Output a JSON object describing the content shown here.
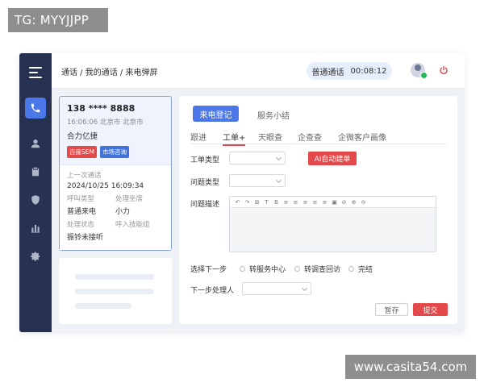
{
  "watermark": {
    "top": "TG: MYYJJPP",
    "bottom": "www.casita54.com"
  },
  "header": {
    "breadcrumb": "通话 / 我的通话 / 来电弹屏",
    "call_type": "普通通话",
    "call_timer": "00:08:12"
  },
  "sidebar": {
    "items": [
      {
        "icon": "phone-icon",
        "active": true
      },
      {
        "icon": "user-icon",
        "active": false
      },
      {
        "icon": "clipboard-icon",
        "active": false
      },
      {
        "icon": "shield-icon",
        "active": false
      },
      {
        "icon": "bar-chart-icon",
        "active": false
      },
      {
        "icon": "gear-icon",
        "active": false
      }
    ]
  },
  "caller": {
    "phone": "138 **** 8888",
    "time_location": "16:06:06  北京市 北京市",
    "company": "合力亿捷",
    "tags": [
      "百度SEM",
      "市场咨询"
    ],
    "last_call_label": "上一次通话",
    "last_call_value": "2024/10/25  16:09:34",
    "call_type_label": "呼叫类型",
    "call_type_value": "普通来电",
    "agent_label": "处理坐席",
    "agent_value": "小力",
    "status_label": "处理状态",
    "status_value": "振铃未接听",
    "skill_label": "呼入技能组",
    "skill_value": ""
  },
  "main": {
    "tabs": [
      "来电登记",
      "服务小结"
    ],
    "subtabs": [
      "跟进",
      "工单+",
      "天眼查",
      "企查查",
      "企微客户画像"
    ],
    "ticket_type_label": "工单类型",
    "ai_button": "AI自动建单",
    "issue_type_label": "问题类型",
    "issue_desc_label": "问题描述",
    "toolbar": [
      "↶",
      "↷",
      "⊞",
      "T",
      "B",
      "≡",
      "≡",
      "≡",
      "≡",
      "≡",
      "▣",
      "⊘",
      "⊕",
      "⊖"
    ],
    "next_step_label": "选择下一步",
    "next_step_options": [
      "转服务中心",
      "转调查回访",
      "完结"
    ],
    "next_handler_label": "下一步处理人",
    "save_button": "暂存",
    "submit_button": "提交"
  },
  "colors": {
    "accent": "#4a78e8",
    "danger": "#e3484a",
    "sidebar": "#273252"
  }
}
